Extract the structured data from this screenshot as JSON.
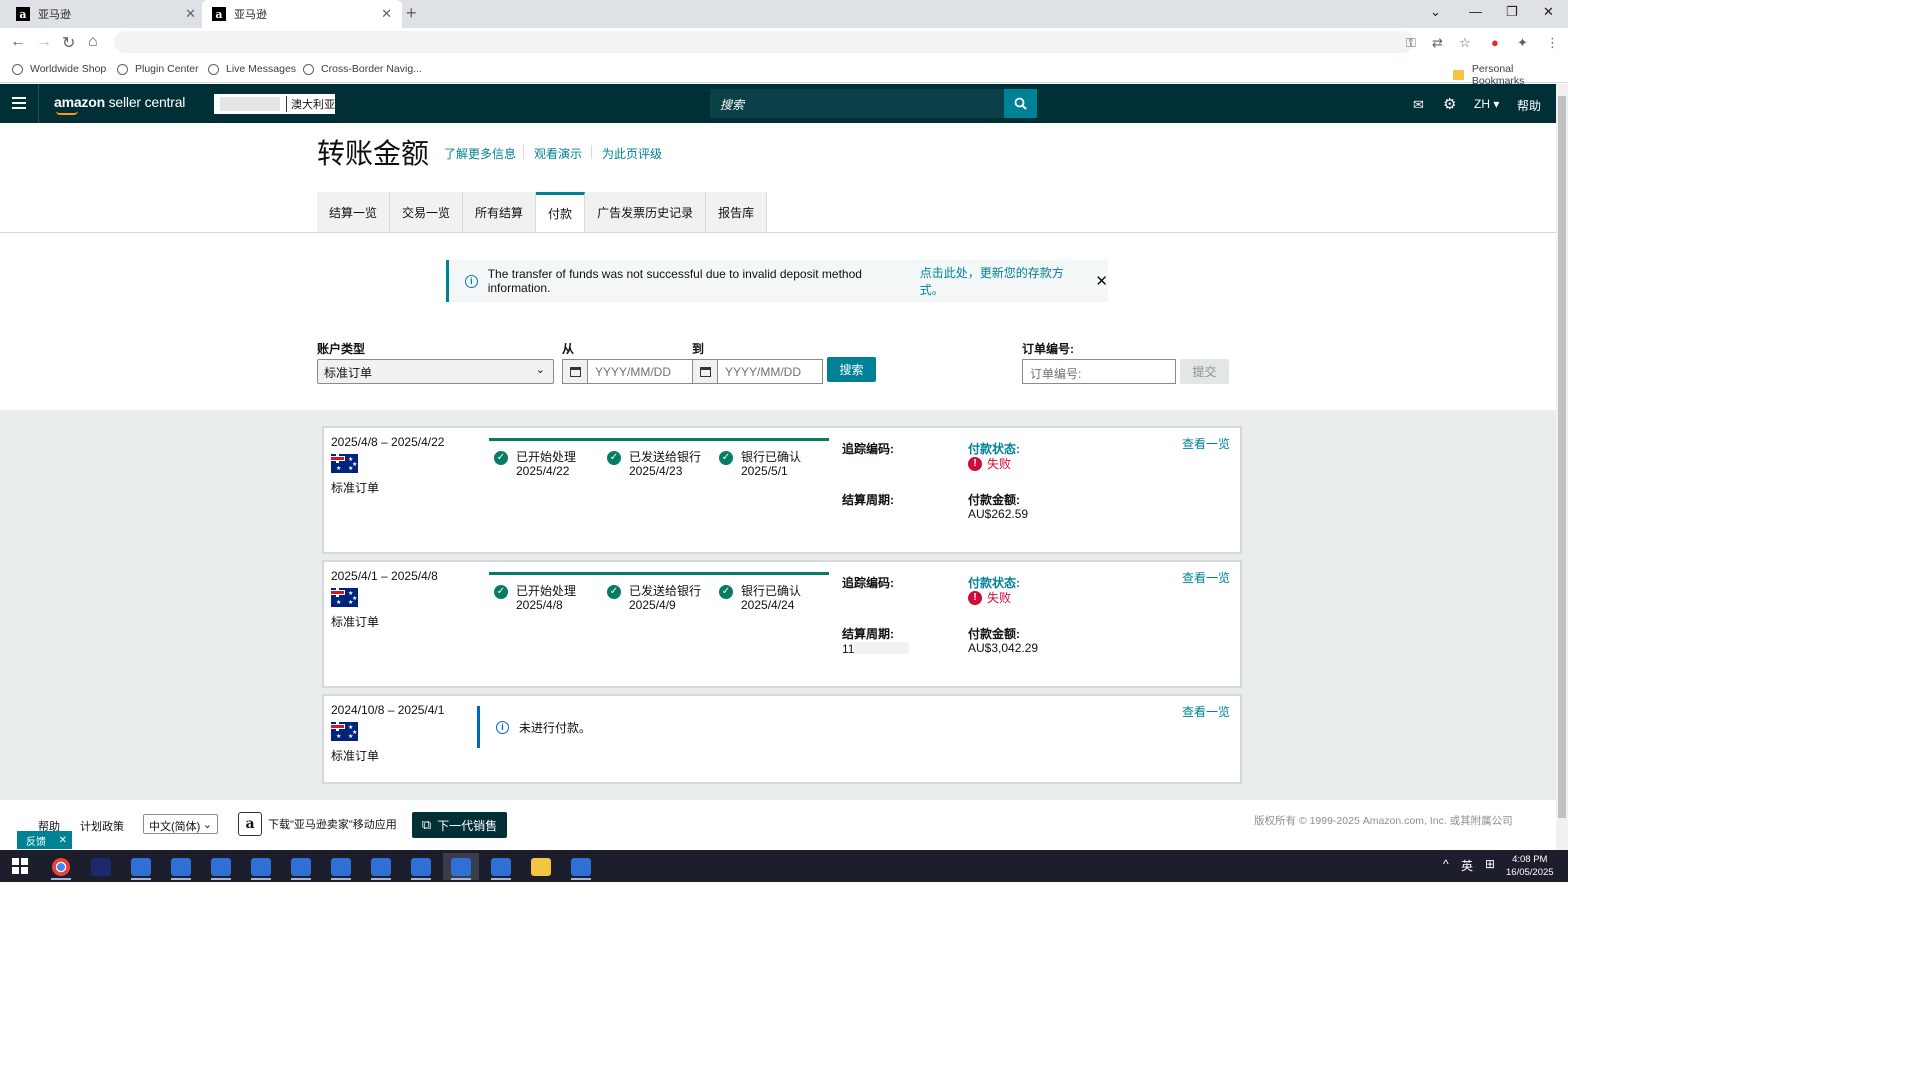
{
  "browser": {
    "tabs": [
      {
        "title": "亚马逊",
        "favicon": "a"
      },
      {
        "title": "亚马逊",
        "favicon": "a"
      }
    ],
    "bookmarks": [
      "Worldwide Shop",
      "Plugin Center",
      "Live Messages",
      "Cross-Border Navig..."
    ],
    "bookmarks_folder": "Personal Bookmarks"
  },
  "header": {
    "logo_bold": "amazon",
    "logo_rest": " seller central",
    "region": "澳大利亚",
    "search_placeholder": "搜索",
    "lang": "ZH",
    "help": "帮助"
  },
  "page": {
    "title": "转账金额",
    "links": [
      "了解更多信息",
      "观看演示",
      "为此页评级"
    ],
    "tabs": [
      "结算一览",
      "交易一览",
      "所有结算",
      "付款",
      "广告发票历史记录",
      "报告库"
    ],
    "active_tab": "付款"
  },
  "alert": {
    "message": "The transfer of funds was not successful due to invalid deposit method information.",
    "link": "点击此处，更新您的存款方式。"
  },
  "filters": {
    "account_type_label": "账户类型",
    "account_type_value": "标准订单",
    "from_label": "从",
    "to_label": "到",
    "date_placeholder": "YYYY/MM/DD",
    "search_button": "搜索",
    "order_label": "订单编号:",
    "order_placeholder": "订单编号:",
    "submit_button": "提交"
  },
  "payments": [
    {
      "date_range": "2025/4/8 – 2025/4/22",
      "account": "标准订单",
      "steps": [
        {
          "label": "已开始处理",
          "date": "2025/4/22"
        },
        {
          "label": "已发送给银行",
          "date": "2025/4/23"
        },
        {
          "label": "银行已确认",
          "date": "2025/5/1"
        }
      ],
      "tracking_label": "追踪编码:",
      "period_label": "结算周期:",
      "status_label": "付款状态:",
      "status": "失败",
      "amount_label": "付款金额:",
      "amount": "AU$262.59",
      "view_link": "查看一览"
    },
    {
      "date_range": "2025/4/1 – 2025/4/8",
      "account": "标准订单",
      "steps": [
        {
          "label": "已开始处理",
          "date": "2025/4/8"
        },
        {
          "label": "已发送给银行",
          "date": "2025/4/9"
        },
        {
          "label": "银行已确认",
          "date": "2025/4/24"
        }
      ],
      "tracking_label": "追踪编码:",
      "period_label": "结算周期:",
      "period_value": "11",
      "status_label": "付款状态:",
      "status": "失败",
      "amount_label": "付款金额:",
      "amount": "AU$3,042.29",
      "view_link": "查看一览"
    },
    {
      "date_range": "2024/10/8 – 2025/4/1",
      "account": "标准订单",
      "message": "未进行付款。",
      "view_link": "查看一览"
    }
  ],
  "footer": {
    "help": "帮助",
    "policy": "计划政策",
    "language": "中文(简体)",
    "app_download": "下载\"亚马逊卖家\"移动应用",
    "next_gen": "下一代销售",
    "copyright": "版权所有 © 1999-2025 Amazon.com, Inc. 或其附属公司",
    "feedback": "反馈"
  },
  "taskbar": {
    "time": "4:08 PM",
    "date": "16/05/2025",
    "ime": "英"
  },
  "colors": {
    "header_bg": "#002f36",
    "accent": "#008296",
    "success": "#067d62",
    "error": "#cc0c39"
  }
}
